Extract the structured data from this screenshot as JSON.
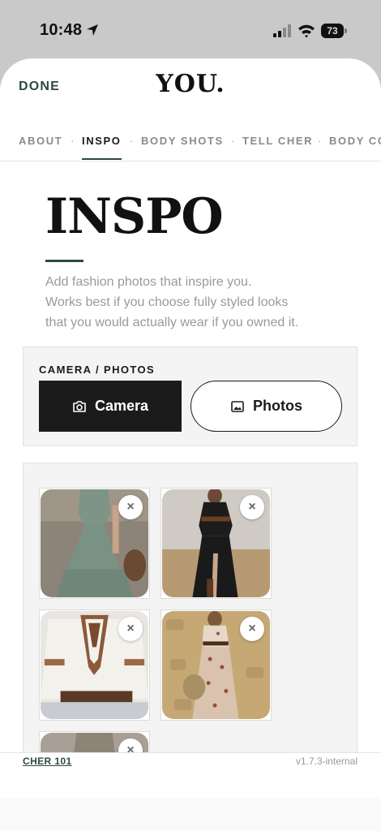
{
  "status_bar": {
    "time": "10:48",
    "battery": "73"
  },
  "header": {
    "done_label": "DONE",
    "logo": "YOU."
  },
  "tabs": [
    {
      "label": "ABOUT",
      "active": false
    },
    {
      "label": "INSPO",
      "active": true
    },
    {
      "label": "BODY SHOTS",
      "active": false
    },
    {
      "label": "TELL CHER",
      "active": false
    },
    {
      "label": "BODY CO",
      "active": false
    }
  ],
  "main": {
    "title": "INSPO",
    "intro_lines": [
      "Add fashion photos that inspire you.",
      "Works best if you choose fully styled looks",
      "that you would actually wear if you owned it."
    ]
  },
  "camera_card": {
    "label": "CAMERA / PHOTOS",
    "camera_button": "Camera",
    "photos_button": "Photos"
  },
  "gallery": {
    "remove_glyph": "×",
    "photos": [
      {
        "icon": "sage-green-tiered-maxi-dress-photo"
      },
      {
        "icon": "black-button-front-maxi-dress-photo"
      },
      {
        "icon": "white-embroidered-boho-blouse-photo"
      },
      {
        "icon": "floral-print-maxi-dress-photo"
      },
      {
        "icon": "partial-outfit-photo"
      }
    ]
  },
  "footer": {
    "link_label": "CHER 101",
    "version": "v1.7.3-internal"
  },
  "colors": {
    "accent": "#2e4a3e",
    "dark_button": "#1b1b1b",
    "panel": "#f3f4f3"
  }
}
